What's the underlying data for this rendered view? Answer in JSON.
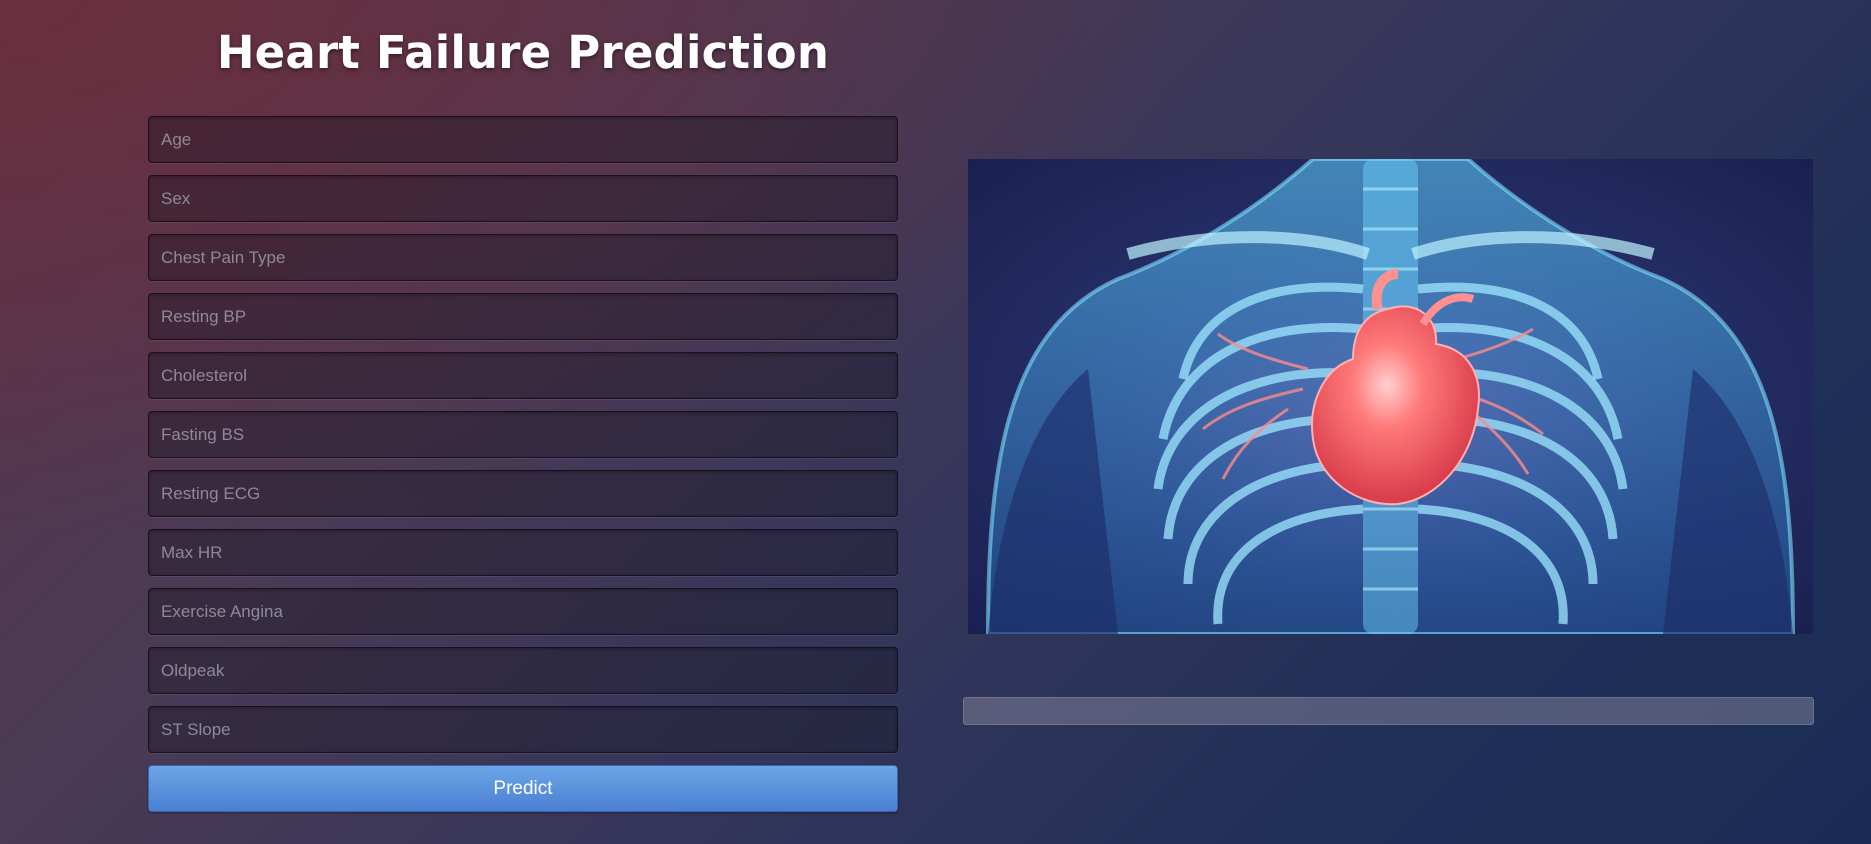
{
  "header": {
    "title": "Heart Failure Prediction"
  },
  "form": {
    "fields": [
      {
        "name": "age-input",
        "placeholder": "Age"
      },
      {
        "name": "sex-input",
        "placeholder": "Sex"
      },
      {
        "name": "chest-pain-type-input",
        "placeholder": "Chest Pain Type"
      },
      {
        "name": "resting-bp-input",
        "placeholder": "Resting BP"
      },
      {
        "name": "cholesterol-input",
        "placeholder": "Cholesterol"
      },
      {
        "name": "fasting-bs-input",
        "placeholder": "Fasting BS"
      },
      {
        "name": "resting-ecg-input",
        "placeholder": "Resting ECG"
      },
      {
        "name": "max-hr-input",
        "placeholder": "Max HR"
      },
      {
        "name": "exercise-angina-input",
        "placeholder": "Exercise Angina"
      },
      {
        "name": "oldpeak-input",
        "placeholder": "Oldpeak"
      },
      {
        "name": "st-slope-input",
        "placeholder": "ST Slope"
      }
    ],
    "predict_label": "Predict"
  },
  "hero": {
    "icon": "heart-anatomy-illustration"
  },
  "result": {
    "text": ""
  },
  "colors": {
    "button": "#5b93dd",
    "heart": "#ff5a5a",
    "skeleton": "#4fc3f7"
  }
}
